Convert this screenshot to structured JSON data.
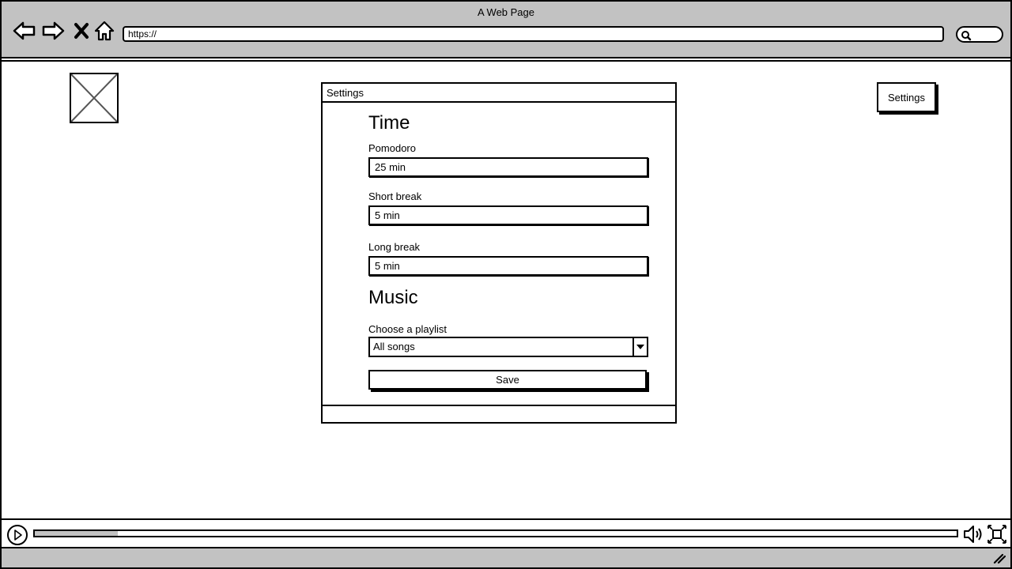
{
  "browser": {
    "title": "A Web Page",
    "url": "https://",
    "icons": [
      "back-arrow-icon",
      "forward-arrow-icon",
      "close-icon",
      "home-icon",
      "search-icon"
    ]
  },
  "header": {
    "settings_button_label": "Settings"
  },
  "dialog": {
    "title": "Settings",
    "time_section": {
      "title": "Time",
      "pomodoro": {
        "label": "Pomodoro",
        "value": "25 min"
      },
      "short_break": {
        "label": "Short break",
        "value": "5 min"
      },
      "long_break": {
        "label": "Long break",
        "value": "5 min"
      }
    },
    "music_section": {
      "title": "Music",
      "playlist": {
        "label": "Choose a playlist",
        "selected": "All songs"
      }
    },
    "save_label": "Save"
  },
  "media": {
    "progress_fraction": 0.09,
    "icons": [
      "play-icon",
      "volume-icon",
      "fullscreen-icon"
    ]
  },
  "colors": {
    "chrome": "#c2c2c2",
    "border": "#000000",
    "background": "#ffffff"
  }
}
